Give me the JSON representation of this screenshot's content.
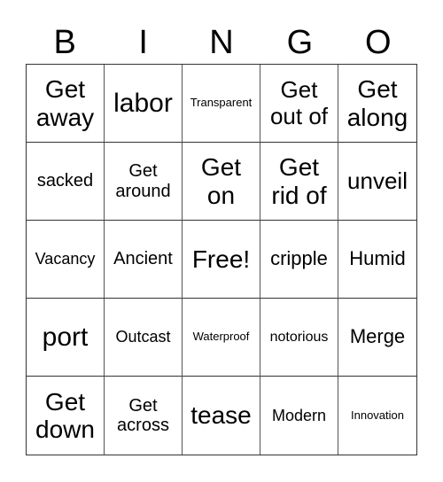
{
  "header": {
    "letters": [
      "B",
      "I",
      "N",
      "G",
      "O"
    ]
  },
  "board": {
    "rows": [
      [
        "Get away",
        "labor",
        "Transparent",
        "Get out of",
        "Get along"
      ],
      [
        "sacked",
        "Get around",
        "Get on",
        "Get rid of",
        "unveil"
      ],
      [
        "Vacancy",
        "Ancient",
        "Free!",
        "cripple",
        "Humid"
      ],
      [
        "port",
        "Outcast",
        "Waterproof",
        "notorious",
        "Merge"
      ],
      [
        "Get down",
        "Get across",
        "tease",
        "Modern",
        "Innovation"
      ]
    ],
    "free_space": "Free!"
  }
}
